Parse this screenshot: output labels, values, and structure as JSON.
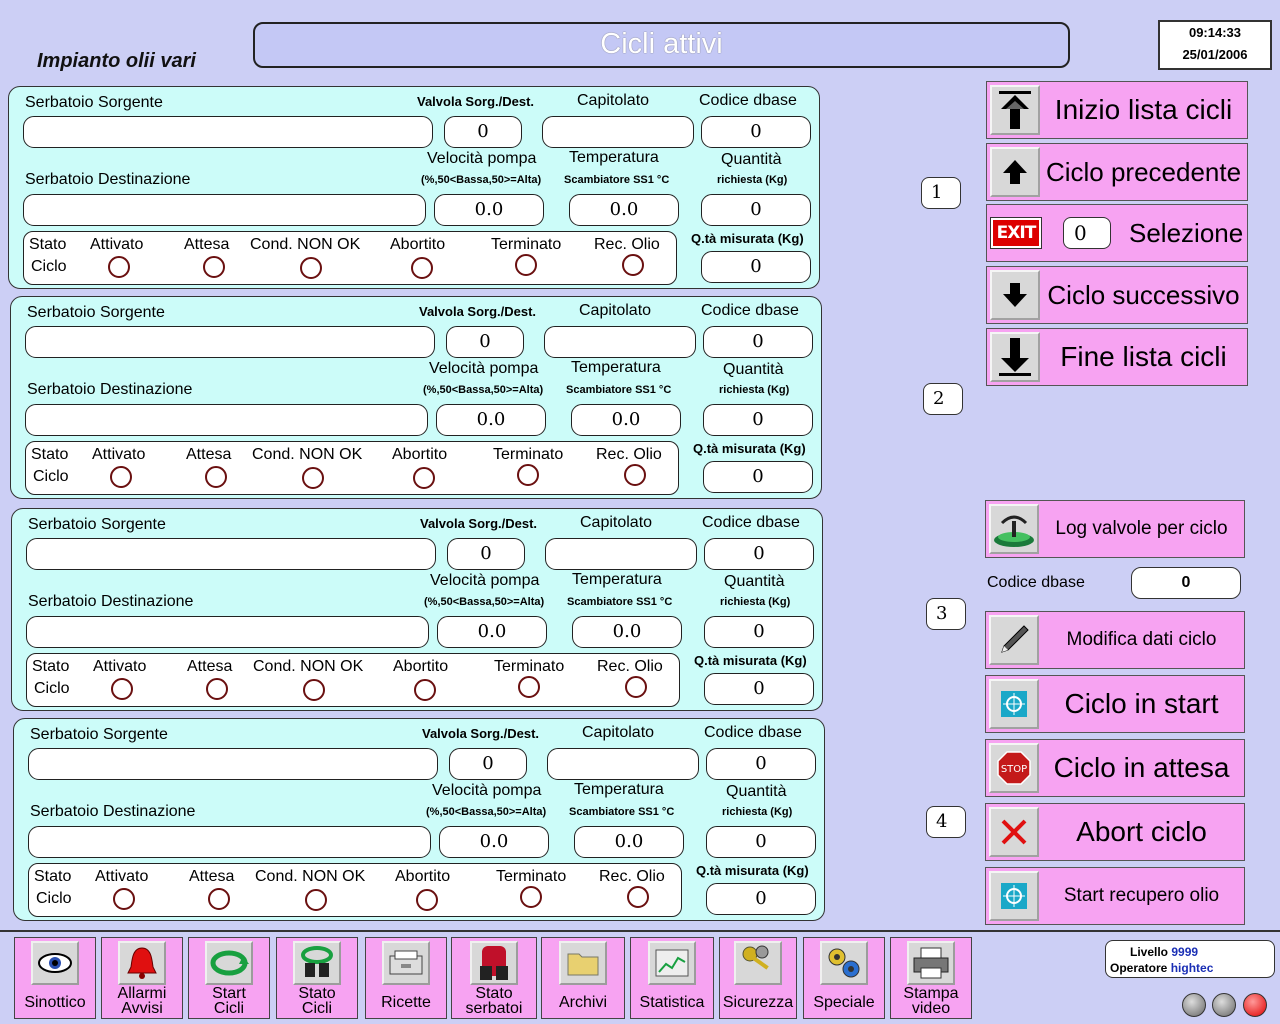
{
  "header": {
    "plant_name": "Impianto olii vari",
    "title": "Cicli attivi",
    "time": "09:14:33",
    "date": "25/01/2006"
  },
  "labels": {
    "source_tank": "Serbatoio Sorgente",
    "valve": "Valvola Sorg./Dest.",
    "spec": "Capitolato",
    "db_code": "Codice dbase",
    "dest_tank": "Serbatoio Destinazione",
    "pump_speed": "Velocità pompa",
    "pump_speed_sub": "(%,50<Bassa,50>=Alta)",
    "temperature": "Temperatura",
    "temperature_sub": "Scambiatore SS1 °C",
    "quantity": "Quantità",
    "quantity_sub": "richiesta (Kg)",
    "measured_qty": "Q.tà misurata (Kg)",
    "state": "Stato",
    "cycle": "Ciclo",
    "activated": "Attivato",
    "waiting": "Attesa",
    "cond_not_ok": "Cond. NON OK",
    "aborted": "Abortito",
    "finished": "Terminato",
    "oil_rec": "Rec. Olio"
  },
  "cycles": [
    {
      "source_tank": "",
      "valve": "0",
      "spec": "",
      "db_code": "0",
      "dest_tank": "",
      "pump_speed": "0.0",
      "temperature": "0.0",
      "quantity": "0",
      "measured_qty": "0",
      "slot": "1"
    },
    {
      "source_tank": "",
      "valve": "0",
      "spec": "",
      "db_code": "0",
      "dest_tank": "",
      "pump_speed": "0.0",
      "temperature": "0.0",
      "quantity": "0",
      "measured_qty": "0",
      "slot": "2"
    },
    {
      "source_tank": "",
      "valve": "0",
      "spec": "",
      "db_code": "0",
      "dest_tank": "",
      "pump_speed": "0.0",
      "temperature": "0.0",
      "quantity": "0",
      "measured_qty": "0",
      "slot": "3"
    },
    {
      "source_tank": "",
      "valve": "0",
      "spec": "",
      "db_code": "0",
      "dest_tank": "",
      "pump_speed": "0.0",
      "temperature": "0.0",
      "quantity": "0",
      "measured_qty": "0",
      "slot": "4"
    }
  ],
  "nav": {
    "first": "Inizio lista cicli",
    "prev": "Ciclo precedente",
    "selection": "Selezione",
    "selection_value": "0",
    "exit_icon_text": "EXIT",
    "next": "Ciclo successivo",
    "last": "Fine lista cicli"
  },
  "actions": {
    "log_valves": "Log valvole per ciclo",
    "db_code_label": "Codice dbase",
    "db_code_value": "0",
    "edit_cycle": "Modifica dati ciclo",
    "start_cycle": "Ciclo in start",
    "stop_icon_text": "STOP",
    "hold_cycle": "Ciclo in attesa",
    "abort_cycle": "Abort ciclo",
    "start_oil_recovery": "Start recupero olio"
  },
  "toolbar": [
    {
      "label1": "Sinottico",
      "label2": "",
      "icon": "eye-icon"
    },
    {
      "label1": "Allarmi",
      "label2": "Avvisi",
      "icon": "bell-icon"
    },
    {
      "label1": "Start",
      "label2": "Cicli",
      "icon": "cycle-arrows-icon"
    },
    {
      "label1": "Stato",
      "label2": "Cicli",
      "icon": "binoculars-cycle-icon"
    },
    {
      "label1": "Ricette",
      "label2": "",
      "icon": "recipe-box-icon"
    },
    {
      "label1": "Stato",
      "label2": "serbatoi",
      "icon": "tank-binoculars-icon"
    },
    {
      "label1": "Archivi",
      "label2": "",
      "icon": "folder-icon"
    },
    {
      "label1": "Statistica",
      "label2": "",
      "icon": "chart-icon"
    },
    {
      "label1": "Sicurezza",
      "label2": "",
      "icon": "keys-icon"
    },
    {
      "label1": "Speciale",
      "label2": "",
      "icon": "gears-icon"
    },
    {
      "label1": "Stampa",
      "label2": "video",
      "icon": "printer-icon"
    }
  ],
  "user": {
    "level_label": "Livello",
    "level_value": "9999",
    "operator_label": "Operatore",
    "operator_value": "hightec"
  },
  "colors": {
    "background": "#cccff5",
    "panel": "#ccfcf9",
    "button": "#f7a3f2",
    "led_border": "#6a1010",
    "status_led_active": "#ff1010",
    "status_led_idle": "#8a8a8a"
  }
}
